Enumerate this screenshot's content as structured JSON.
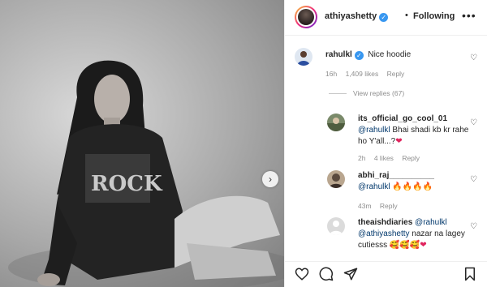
{
  "post": {
    "author": "athiyashetty",
    "separator": "•",
    "follow_status": "Following",
    "more_icon": "more-horizontal-icon"
  },
  "main_comment": {
    "username": "rahulkl",
    "text": "Nice hoodie",
    "time": "16h",
    "likes": "1,409 likes",
    "reply": "Reply"
  },
  "view_replies": "View replies (67)",
  "replies": [
    {
      "username": "its_official_go_cool_01",
      "mention": "@rahulkl",
      "text": " Bhai shadi kb kr rahe ho Y'all...?",
      "emoji": "❤",
      "time": "2h",
      "likes": "4 likes",
      "reply": "Reply"
    },
    {
      "username": "abhi_raj__________",
      "mention": "@rahulkl",
      "text": " 🔥🔥🔥🔥",
      "time": "43m",
      "reply": "Reply"
    },
    {
      "username": "theaishdiaries",
      "mention": "@rahulkl",
      "mention2": "@athiyashetty",
      "text": " nazar na lagey cutiesss 🥰🥰🥰",
      "emoji": "❤"
    }
  ],
  "colors": {
    "mention": "#00376b",
    "verified": "#3897f0",
    "meta": "#8e8e8e"
  }
}
